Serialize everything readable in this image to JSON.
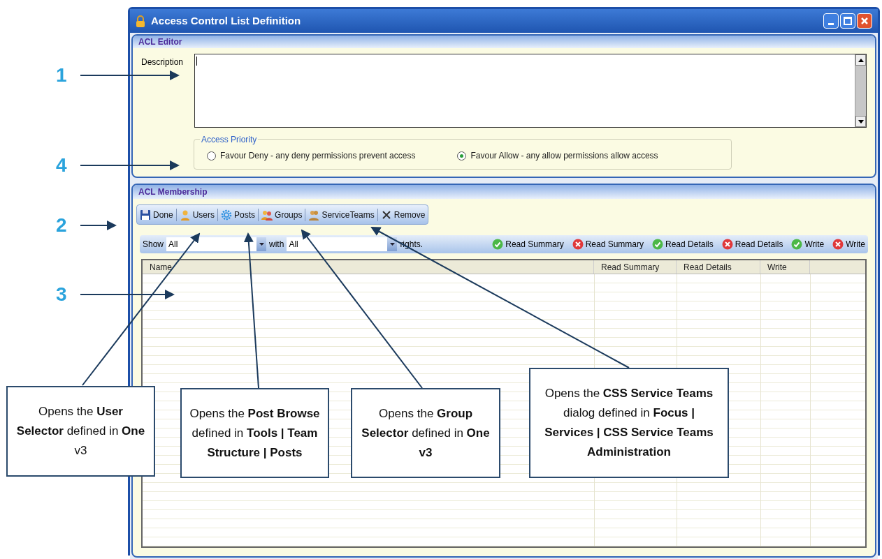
{
  "window": {
    "title": "Access Control List Definition"
  },
  "acl_editor": {
    "title": "ACL Editor",
    "description_label": "Description",
    "access_priority": {
      "title": "Access Priority",
      "options": [
        {
          "label": "Favour Deny - any deny permissions prevent access",
          "selected": false
        },
        {
          "label": "Favour Allow - any allow permissions allow access",
          "selected": true
        }
      ]
    }
  },
  "acl_membership": {
    "title": "ACL Membership",
    "toolbar": [
      {
        "label": "Done"
      },
      {
        "label": "Users"
      },
      {
        "label": "Posts"
      },
      {
        "label": "Groups"
      },
      {
        "label": "ServiceTeams"
      },
      {
        "label": "Remove"
      }
    ],
    "filter": {
      "show_label": "Show",
      "show_value": "All",
      "with_label": "with",
      "with_value": "All",
      "rights_label": "rights."
    },
    "legend": [
      {
        "label": "Read Summary",
        "kind": "allow"
      },
      {
        "label": "Read Summary",
        "kind": "deny"
      },
      {
        "label": "Read Details",
        "kind": "allow"
      },
      {
        "label": "Read Details",
        "kind": "deny"
      },
      {
        "label": "Write",
        "kind": "allow"
      },
      {
        "label": "Write",
        "kind": "deny"
      }
    ],
    "table": {
      "columns": [
        "Name",
        "Read Summary",
        "Read Details",
        "Write"
      ]
    }
  },
  "annotations": {
    "markers": [
      "1",
      "4",
      "2",
      "3"
    ],
    "callouts": [
      "Opens the **User Selector** defined in **One** v3",
      "Opens the **Post Browse** defined in **Tools | Team Structure | Posts**",
      "Opens the **Group Selector** defined in **One v3**",
      "Opens the **CSS Service Teams** dialog defined in **Focus | Services | CSS Service Teams Administration**"
    ]
  }
}
